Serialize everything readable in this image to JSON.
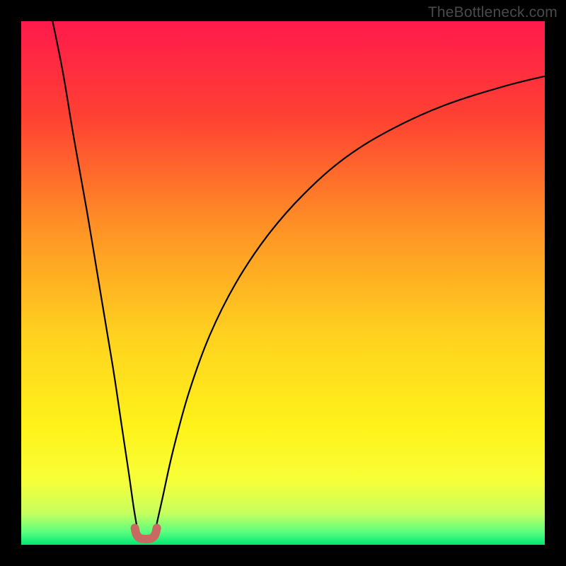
{
  "watermark": "TheBottleneck.com",
  "chart_data": {
    "type": "line",
    "title": "",
    "xlabel": "",
    "ylabel": "",
    "xlim": [
      0,
      100
    ],
    "ylim": [
      0,
      100
    ],
    "grid": false,
    "legend": false,
    "background_gradient": {
      "stops": [
        {
          "offset": 0.0,
          "color": "#ff1a4b"
        },
        {
          "offset": 0.18,
          "color": "#ff4033"
        },
        {
          "offset": 0.4,
          "color": "#ff9425"
        },
        {
          "offset": 0.6,
          "color": "#ffd21f"
        },
        {
          "offset": 0.78,
          "color": "#fff31a"
        },
        {
          "offset": 0.88,
          "color": "#f6ff3a"
        },
        {
          "offset": 0.94,
          "color": "#c5ff5e"
        },
        {
          "offset": 0.975,
          "color": "#5dff7f"
        },
        {
          "offset": 1.0,
          "color": "#00e873"
        }
      ]
    },
    "series": [
      {
        "name": "left-branch",
        "x": [
          6.0,
          8.0,
          10.0,
          12.5,
          15.0,
          17.5,
          19.0,
          20.5,
          21.5,
          22.3
        ],
        "values": [
          100,
          90.0,
          78.0,
          64.0,
          49.0,
          34.0,
          24.0,
          14.0,
          7.0,
          2.3
        ]
      },
      {
        "name": "right-branch",
        "x": [
          25.5,
          27.0,
          29.0,
          32.0,
          36.0,
          41.0,
          47.0,
          54.0,
          62.0,
          71.0,
          81.0,
          92.0,
          100.0
        ],
        "values": [
          2.3,
          9.0,
          18.0,
          29.0,
          40.0,
          50.0,
          59.0,
          67.0,
          74.0,
          79.5,
          84.0,
          87.5,
          89.5
        ]
      },
      {
        "name": "trough-marker",
        "x": [
          21.7,
          22.0,
          22.6,
          23.4,
          24.2,
          25.0,
          25.6,
          25.9
        ],
        "values": [
          3.2,
          2.0,
          1.3,
          1.1,
          1.1,
          1.3,
          2.0,
          3.2
        ]
      }
    ],
    "styles": {
      "left-branch": {
        "stroke": "#000000",
        "width": 2.2
      },
      "right-branch": {
        "stroke": "#000000",
        "width": 2.2
      },
      "trough-marker": {
        "stroke": "#c96a62",
        "width": 12,
        "linecap": "round"
      }
    }
  }
}
